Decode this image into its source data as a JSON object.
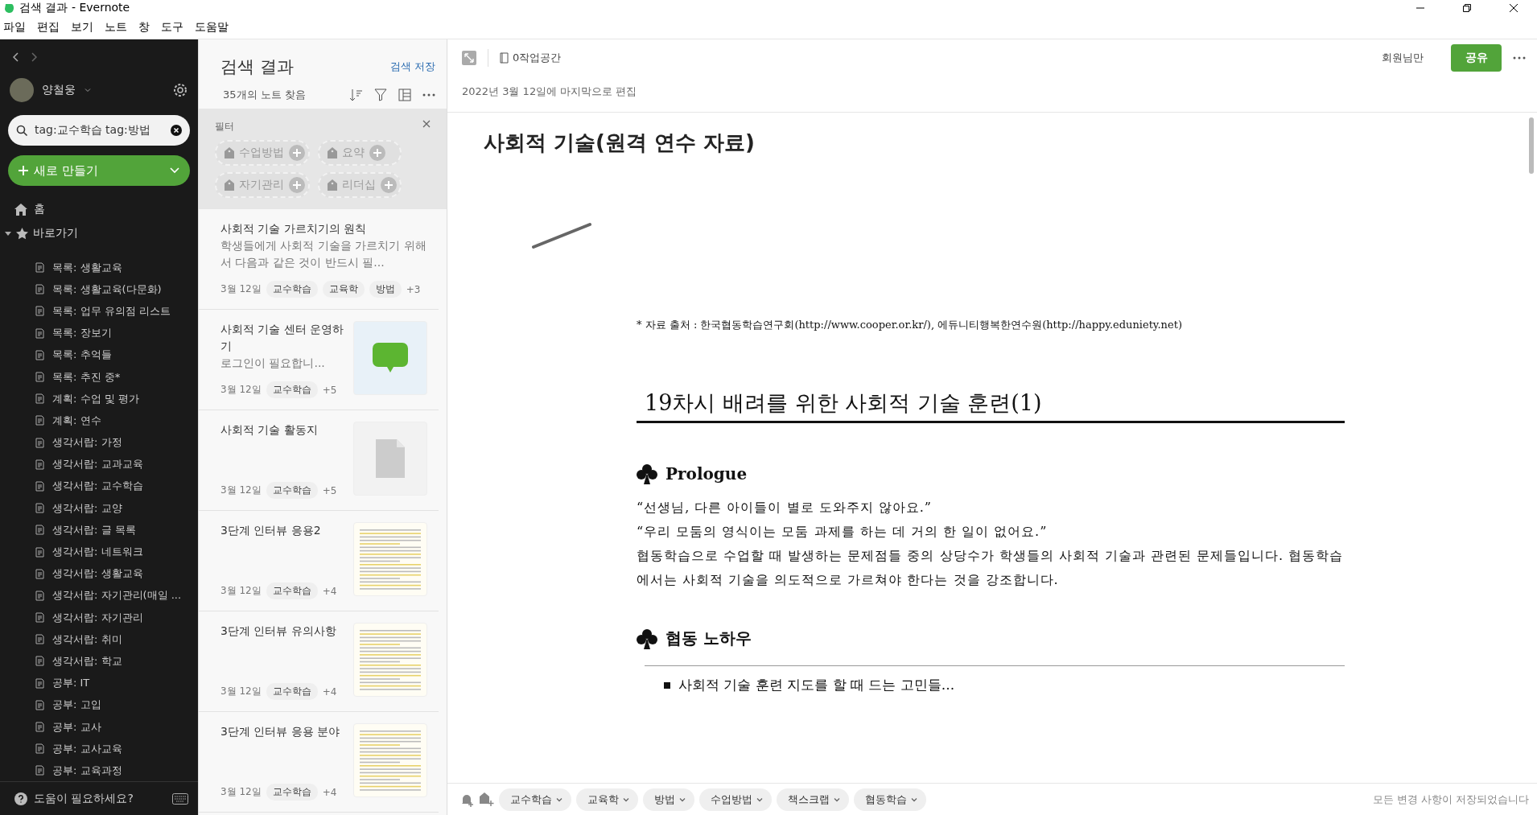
{
  "window": {
    "title": "검색 결과 - Evernote"
  },
  "menu": [
    "파일",
    "편집",
    "보기",
    "노트",
    "창",
    "도구",
    "도움말"
  ],
  "sidebar": {
    "user": "양철웅",
    "search": {
      "value": "tag:교수학습 tag:방법"
    },
    "new_button": "새로 만들기",
    "home": "홈",
    "shortcuts": {
      "label": "바로가기",
      "expanded": true,
      "children": [
        {
          "label": "목록: 생활교육"
        },
        {
          "label": "목록: 생활교육(다문화)"
        },
        {
          "label": "목록: 업무 유의점 리스트"
        },
        {
          "label": "목록: 장보기"
        },
        {
          "label": "목록: 추억들"
        },
        {
          "label": "목록: 추진 중*"
        },
        {
          "label": "계획: 수업 및 평가"
        },
        {
          "label": "계획: 연수"
        },
        {
          "label": "생각서랍: 가정"
        },
        {
          "label": "생각서랍: 교과교육"
        },
        {
          "label": "생각서랍: 교수학습"
        },
        {
          "label": "생각서랍: 교양"
        },
        {
          "label": "생각서랍: 글 목록"
        },
        {
          "label": "생각서랍: 네트워크"
        },
        {
          "label": "생각서랍: 생활교육"
        },
        {
          "label": "생각서랍: 자기관리(매일 ..."
        },
        {
          "label": "생각서랍: 자기관리"
        },
        {
          "label": "생각서랍: 취미"
        },
        {
          "label": "생각서랍: 학교"
        },
        {
          "label": "공부: IT"
        },
        {
          "label": "공부: 고입"
        },
        {
          "label": "공부: 교사"
        },
        {
          "label": "공부: 교사교육"
        },
        {
          "label": "공부: 교육과정"
        }
      ]
    },
    "help": "도움이 필요하세요?"
  },
  "note_list": {
    "title": "검색 결과",
    "save_search": "검색 저장",
    "count": "35개의 노트 찾음",
    "filter": {
      "label": "필터",
      "tags": [
        "수업방법",
        "요약",
        "자기관리",
        "리더십"
      ]
    },
    "notes": [
      {
        "title": "사회적 기술 가르치기의 원칙",
        "snippet": "학생들에게 사회적 기술을 가르치기 위해서 다음과 같은 것이 반드시 필...",
        "date": "3월 12일",
        "tags": [
          "교수학습",
          "교육학",
          "방법"
        ],
        "more": "+3",
        "kind": "text"
      },
      {
        "title": "사회적 기술 센터 운영하기",
        "snippet": "로그인이 필요합니...",
        "date": "3월 12일",
        "tags": [
          "교수학습"
        ],
        "more": "+5",
        "kind": "blog"
      },
      {
        "title": "사회적 기술 활동지",
        "date": "3월 12일",
        "tags": [
          "교수학습"
        ],
        "more": "+5",
        "kind": "file"
      },
      {
        "title": "3단계 인터뷰 응용2",
        "date": "3월 12일",
        "tags": [
          "교수학습"
        ],
        "more": "+4",
        "kind": "document"
      },
      {
        "title": "3단계 인터뷰 유의사항",
        "date": "3월 12일",
        "tags": [
          "교수학습"
        ],
        "more": "+4",
        "kind": "document"
      },
      {
        "title": "3단계 인터뷰 응용 분야",
        "date": "3월 12일",
        "tags": [
          "교수학습"
        ],
        "more": "+4",
        "kind": "document"
      }
    ]
  },
  "editor": {
    "workspace": "0작업공간",
    "access": "회원님만",
    "share": "공유",
    "edited": "2022년 3월 12일에 마지막으로 편집",
    "title": "사회적 기술(원격 연수 자료)",
    "document": {
      "source": "* 자료 출처 : 한국협동학습연구회(http://www.cooper.or.kr/), 에듀니티행복한연수원(http://happy.eduniety.net)",
      "heading": "19차시 배려를 위한 사회적 기술 훈련(1)",
      "section_1": "Prologue",
      "paragraphs": [
        "“선생님, 다른 아이들이 별로 도와주지 않아요.”",
        "“우리 모둠의 영식이는 모둠 과제를 하는 데 거의 한 일이 없어요.”",
        "협동학습으로 수업할 때 발생하는 문제점들 중의 상당수가 학생들의 사회적 기술과 관련된 문제들입니다. 협동학습에서는 사회적 기술을 의도적으로 가르쳐야 한다는 것을 강조합니다."
      ],
      "section_2": "협동 노하우",
      "bullet": "사회적 기술 훈련 지도를 할 때 드는 고민들..."
    },
    "tags": [
      "교수학습",
      "교육학",
      "방법",
      "수업방법",
      "책스크랩",
      "협동학습"
    ],
    "status": "모든 변경 사항이 저장되었습니다"
  }
}
